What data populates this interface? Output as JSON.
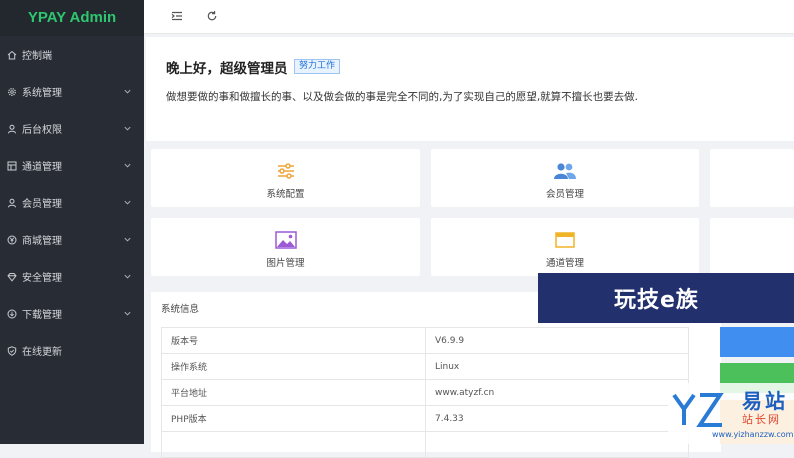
{
  "app": {
    "title": "YPAY Admin"
  },
  "sidebar": {
    "items": [
      {
        "label": "控制端",
        "icon": "home-icon",
        "has_caret": false
      },
      {
        "label": "系统管理",
        "icon": "gear-icon",
        "has_caret": true
      },
      {
        "label": "后台权限",
        "icon": "user-icon",
        "has_caret": true
      },
      {
        "label": "通道管理",
        "icon": "channel-icon",
        "has_caret": true
      },
      {
        "label": "会员管理",
        "icon": "member-icon",
        "has_caret": true
      },
      {
        "label": "商城管理",
        "icon": "yen-icon",
        "has_caret": true
      },
      {
        "label": "安全管理",
        "icon": "diamond-icon",
        "has_caret": true
      },
      {
        "label": "下载管理",
        "icon": "download-icon",
        "has_caret": true
      },
      {
        "label": "在线更新",
        "icon": "shield-check-icon",
        "has_caret": false
      }
    ]
  },
  "topbar": {
    "menu_icon": "menu-fold-icon",
    "refresh_icon": "refresh-icon"
  },
  "welcome": {
    "title": "晚上好，超级管理员",
    "badge": "努力工作",
    "text": "做想要做的事和做擅长的事、以及做会做的事是完全不同的,为了实现自己的愿望,就算不擅长也要去做."
  },
  "shortcuts": [
    {
      "label": "系统配置",
      "icon": "sliders-icon"
    },
    {
      "label": "会员管理",
      "icon": "users-icon"
    },
    {
      "label": "图片管理",
      "icon": "image-icon"
    },
    {
      "label": "通道管理",
      "icon": "window-icon"
    }
  ],
  "system_info": {
    "title": "系统信息",
    "rows": [
      {
        "key": "版本号",
        "value": "V6.9.9"
      },
      {
        "key": "操作系统",
        "value": "Linux"
      },
      {
        "key": "平台地址",
        "value": "www.atyzf.cn"
      },
      {
        "key": "PHP版本",
        "value": "7.4.33"
      }
    ]
  },
  "overlays": {
    "banner_text": "玩技e族",
    "watermark_text": "易站",
    "watermark_sub": "站长网",
    "watermark_url": "www.yizhanzzw.com"
  },
  "colors": {
    "sidebar": "#282c34",
    "brand": "#2ec770",
    "accent_blue": "#3f8ef0",
    "accent_green": "#4cc05a",
    "banner": "#23306e"
  }
}
